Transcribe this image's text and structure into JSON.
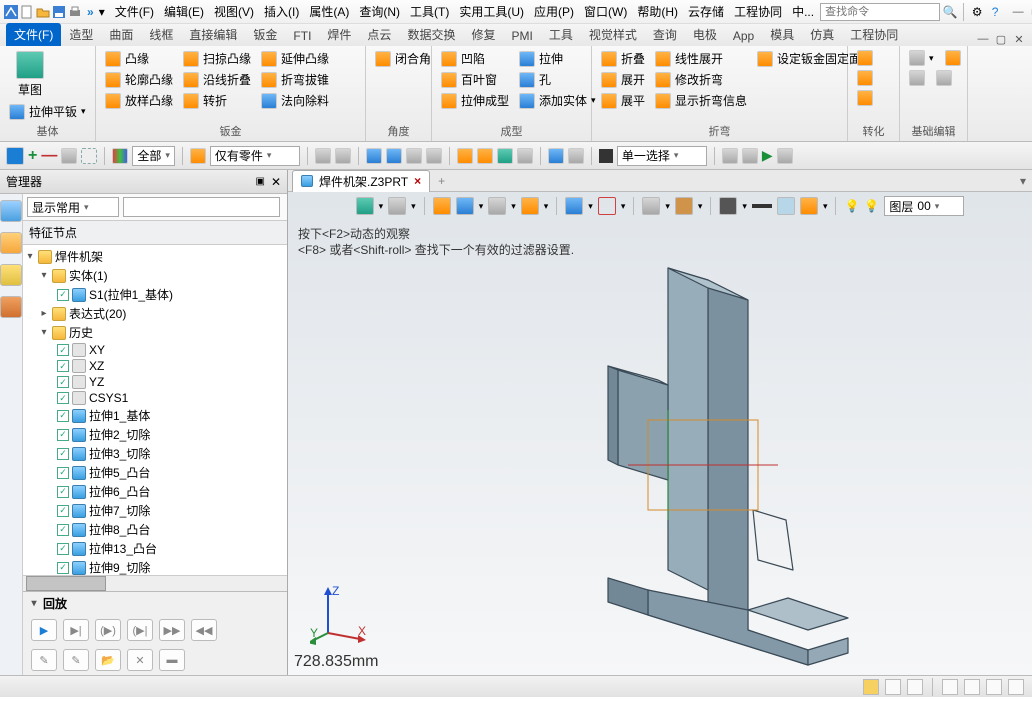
{
  "titlebar": {
    "separator": "»",
    "menus": [
      "文件(F)",
      "编辑(E)",
      "视图(V)",
      "插入(I)",
      "属性(A)",
      "查询(N)",
      "工具(T)",
      "实用工具(U)",
      "应用(P)",
      "窗口(W)",
      "帮助(H)",
      "云存储",
      "工程协同",
      "中..."
    ],
    "search_placeholder": "查找命令"
  },
  "ribbon": {
    "tabs": [
      "文件(F)",
      "造型",
      "曲面",
      "线框",
      "直接编辑",
      "钣金",
      "FTI",
      "焊件",
      "点云",
      "数据交换",
      "修复",
      "PMI",
      "工具",
      "视觉样式",
      "查询",
      "电极",
      "App",
      "模具",
      "仿真",
      "工程协同"
    ],
    "active": 0,
    "groups": [
      {
        "label": "基体",
        "big": [
          {
            "label": "草图"
          },
          {
            "label": "拉伸平钣",
            "dd": true
          }
        ]
      },
      {
        "label": "钣金",
        "cols": [
          [
            "凸缘",
            "轮廓凸缘",
            "放样凸缘"
          ],
          [
            "扫掠凸缘",
            "沿线折叠",
            "转折"
          ],
          [
            "延伸凸缘",
            "折弯拔锥",
            "法向除料"
          ],
          [
            "闭合角"
          ]
        ]
      },
      {
        "label": "角度"
      },
      {
        "label": "成型",
        "cols": [
          [
            "凹陷",
            "百叶窗",
            "拉伸成型"
          ],
          [
            "拉伸",
            "孔",
            "添加实体"
          ]
        ]
      },
      {
        "label": "折弯",
        "cols": [
          [
            "折叠",
            "展开",
            "展平"
          ],
          [
            "线性展开",
            "修改折弯",
            "显示折弯信息"
          ],
          [
            "设定钣金固定面"
          ]
        ]
      },
      {
        "label": "转化"
      },
      {
        "label": "基础编辑"
      }
    ]
  },
  "toolbar2": {
    "combo1": "全部",
    "combo2": "仅有零件",
    "combo3": "单一选择"
  },
  "manager": {
    "title": "管理器",
    "display_combo": "显示常用",
    "root_label": "特征节点",
    "tree": {
      "root": "焊件机架",
      "entity_folder": "实体(1)",
      "entity_item": "S1(拉伸1_基体)",
      "expr_folder": "表达式(20)",
      "history": "历史",
      "planes": [
        "XY",
        "XZ",
        "YZ"
      ],
      "csys": "CSYS1",
      "features": [
        "拉伸1_基体",
        "拉伸2_切除",
        "拉伸3_切除",
        "拉伸5_凸台",
        "拉伸6_凸台",
        "拉伸7_切除",
        "拉伸8_凸台",
        "拉伸13_凸台",
        "拉伸9_切除"
      ]
    },
    "rewind_label": "回放"
  },
  "viewport": {
    "tab_name": "焊件机架.Z3PRT",
    "hint1": "按下<F2>动态的观察",
    "hint2": "<F8> 或者<Shift-roll> 查找下一个有效的过滤器设置.",
    "axes": {
      "x": "X",
      "y": "Y",
      "z": "Z"
    },
    "measurement": "728.835mm",
    "layer_label": "图层"
  },
  "icons": {
    "filter": "filter",
    "search": "search",
    "gear": "gear",
    "help": "help",
    "sun": "sun"
  }
}
